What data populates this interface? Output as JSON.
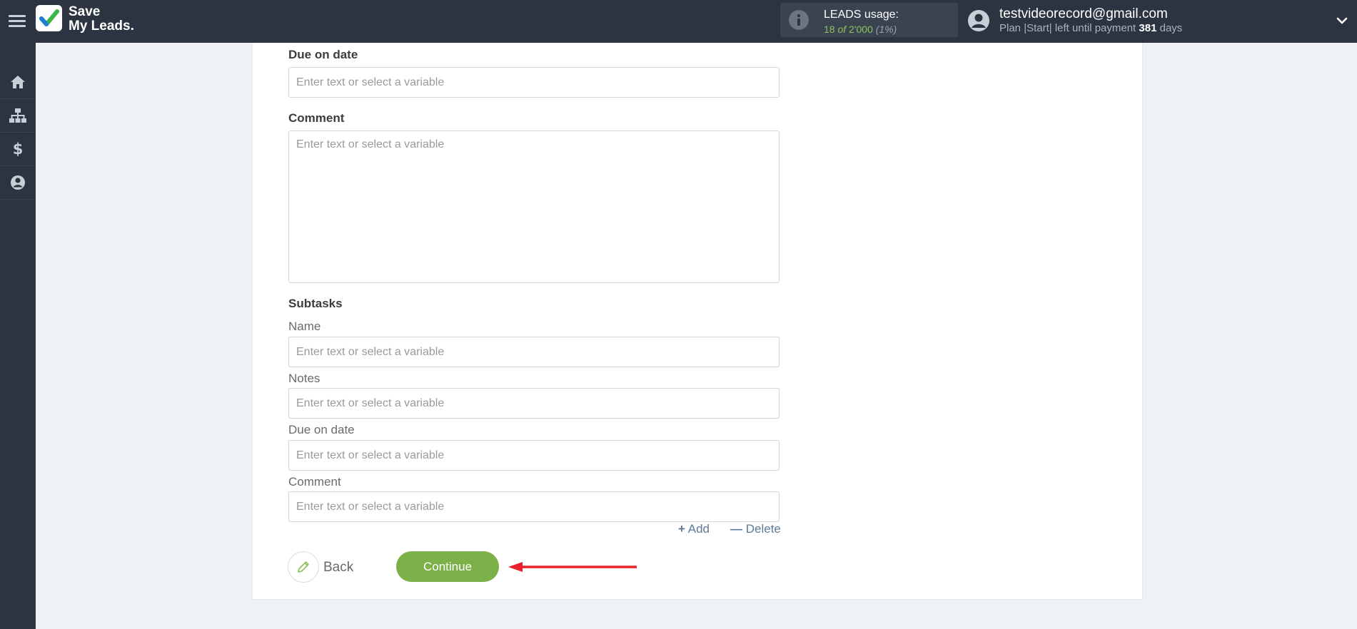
{
  "header": {
    "logo_line1": "Save",
    "logo_line2": "My Leads.",
    "usage_title": "LEADS usage:",
    "usage_used": "18",
    "usage_of": "of",
    "usage_total": "2'000",
    "usage_percent": "(1%)",
    "user_email": "testvideorecord@gmail.com",
    "plan_prefix": "Plan |Start| left until payment",
    "plan_days": "381",
    "plan_suffix": "days"
  },
  "sidebar": {
    "items": [
      {
        "icon": "home-icon"
      },
      {
        "icon": "sitemap-icon"
      },
      {
        "icon": "dollar-icon"
      },
      {
        "icon": "user-circle-icon"
      }
    ]
  },
  "form": {
    "placeholder": "Enter text or select a variable",
    "due_on_date_label": "Due on date",
    "comment_label": "Comment",
    "subtasks_label": "Subtasks",
    "subtask_name_label": "Name",
    "subtask_notes_label": "Notes",
    "subtask_due_label": "Due on date",
    "subtask_comment_label": "Comment",
    "add_label": "Add",
    "delete_label": "Delete"
  },
  "footer": {
    "back_label": "Back",
    "continue_label": "Continue"
  },
  "colors": {
    "topbar": "#2b3440",
    "accent_green": "#7cb14a",
    "arrow_red": "#e8202a",
    "link_blue": "#5e7a96"
  }
}
